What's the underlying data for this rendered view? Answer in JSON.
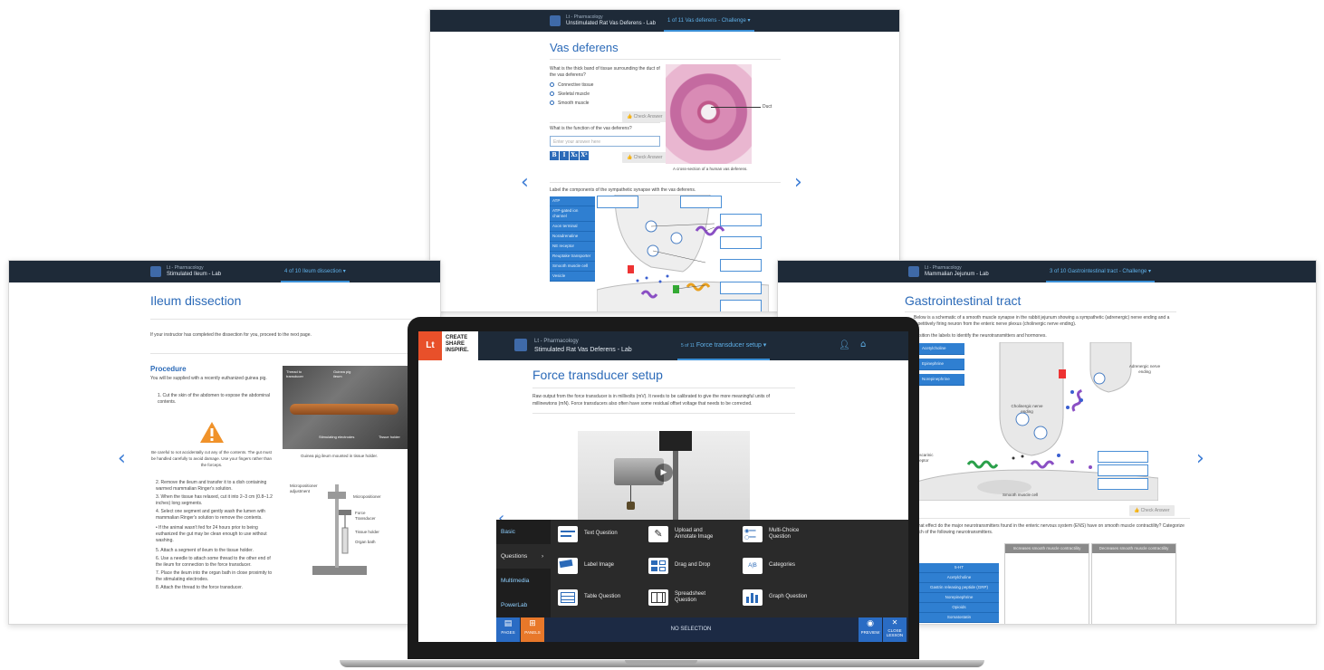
{
  "top_panel": {
    "course_sub": "Lt - Pharmacology",
    "course_main": "Unstimulated Rat Vas Deferens - Lab",
    "tab": "1 of 11  Vas deferens - Challenge ▾",
    "title": "Vas deferens",
    "q1": "What is the thick band of tissue surrounding the duct of the vas deferens?",
    "options": [
      "Connective tissue",
      "Skeletal muscle",
      "Smooth muscle"
    ],
    "check_label": "Check Answer",
    "q2": "What is the function of the vas deferens?",
    "input_placeholder": "Enter your answer here",
    "format_buttons": [
      "B",
      "I",
      "X₂",
      "X²"
    ],
    "duct_label": "Duct",
    "image_caption": "A cross-section of a human vas deferens.",
    "q3": "Label the components of the sympathetic synapse with the vas deferens.",
    "label_tags": [
      "ATP",
      "ATP-gated ion channel",
      "Axon terminal",
      "Noradrenaline",
      "NE receptor",
      "Reuptake transporter",
      "Smooth muscle cell",
      "Vesicle"
    ]
  },
  "left_panel": {
    "course_sub": "Lt - Pharmacology",
    "course_main": "Stimulated Ileum - Lab",
    "tab": "4 of 10  Ileum dissection ▾",
    "title": "Ileum dissection",
    "intro": "If your instructor has completed the dissection for you, proceed to the next page.",
    "procedure_heading": "Procedure",
    "procedure_intro": "You will be supplied with a recently euthanized guinea pig.",
    "step1": "1. Cut the skin of the abdomen to expose the abdominal contents.",
    "warning": "Be careful to not accidentally cut any of the contents. The gut must be handled carefully to avoid damage. Use your fingers rather than the forceps.",
    "steps": [
      "2. Remove the ileum and transfer it to a dish containing warmed mammalian Ringer's solution.",
      "3. When the tissue has relaxed, cut it into 2–3 cm (0.8–1.2 inches) long segments.",
      "4. Select one segment and gently wash the lumen with mammalian Ringer's solution to remove the contents.",
      "• If the animal wasn't fed for 24 hours prior to being euthanized the gut may be clean enough to use without washing.",
      "5. Attach a segment of ileum to the tissue holder.",
      "6. Use a needle to attach some thread to the other end of the ileum for connection to the force transducer.",
      "7. Place the ileum into the organ bath in close proximity to the stimulating electrodes.",
      "8. Attach the thread to the force transducer."
    ],
    "photo_caption": "Guinea pig ileum mounted in tissue holder.",
    "photo_labels": [
      "Thread to transducer",
      "Guinea pig ileum",
      "Stimulating electrodes",
      "Tissue holder"
    ],
    "apparatus_labels": [
      "Micropositioner adjustment",
      "Micropositioner",
      "Force Transducer",
      "Tissue holder",
      "Organ bath"
    ]
  },
  "right_panel": {
    "course_sub": "Lt - Pharmacology",
    "course_main": "Mammalian Jejunum - Lab",
    "tab": "3 of 10  Gastrointestinal tract - Challenge ▾",
    "title": "Gastrointestinal tract",
    "intro": "Below is a schematic of a smooth muscle synapse in the rabbit jejunum showing a sympathetic (adrenergic) nerve ending and a repetitively firing neuron from the enteric nerve plexus (cholinergic nerve ending).",
    "instruction": "Position the labels to identify the neurotransmitters and hormones.",
    "labels": [
      "Acetylcholine",
      "Epinephrine",
      "Norepinephrine"
    ],
    "diagram_labels": [
      "Adrenergic nerve ending",
      "Cholinergic nerve ending",
      "muscarinic receptor",
      "Smooth muscle cell"
    ],
    "check_label": "Check Answer",
    "question": "What effect do the major neurotransmitters found in the enteric nervous system (ENS) have on smooth muscle contractility? Categorize each of the following neurotransmitters.",
    "col_headers": [
      "Increases smooth muscle contractility",
      "Decreases smooth muscle contractility"
    ],
    "items": [
      "5-HT",
      "Acetylcholine",
      "Gastrin releasing peptide (GRP)",
      "Norepinephrine",
      "Opioids",
      "Somatostatin"
    ]
  },
  "laptop": {
    "logo": "Lt",
    "tagline": [
      "CREATE",
      "SHARE",
      "INSPIRE."
    ],
    "course_sub": "Lt - Pharmacology",
    "course_main": "Stimulated Rat Vas Deferens - Lab",
    "tab_page": "5 of 11",
    "tab_title": "Force transducer setup ▾",
    "title": "Force transducer setup",
    "body": "Raw output from the force transducer is in millivolts (mV). It needs to be calibrated to give the more meaningful units of millinewtons (mN). Force transducers also often have some residual offset voltage that needs to be corrected.",
    "menu": [
      "Basic",
      "Questions",
      "Multimedia",
      "PowerLab"
    ],
    "tiles": [
      "Text Question",
      "Upload and Annotate Image",
      "Multi-Choice Question",
      "Label Image",
      "Drag and Drop",
      "Categories",
      "Table Question",
      "Spreadsheet Question",
      "Graph Question"
    ],
    "status": "NO SELECTION",
    "bottom_buttons": [
      "PAGES",
      "PANELS",
      "PREVIEW",
      "CLOSE LESSON"
    ]
  },
  "colors": {
    "accent": "#2b6ab8",
    "topbar": "#1e2a38",
    "logo": "#e8502a",
    "status_bar": "#1c2a44"
  }
}
